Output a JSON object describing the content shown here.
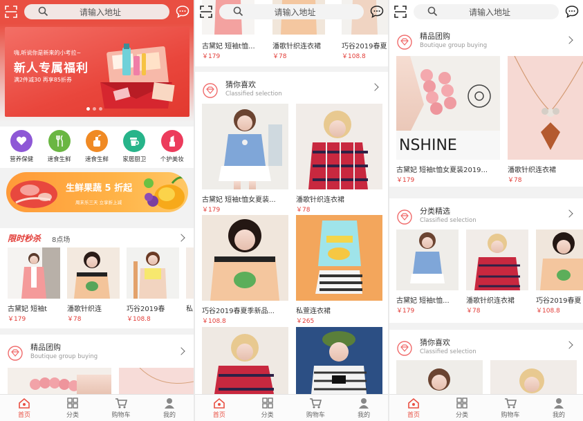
{
  "search": {
    "placeholder": "请输入地址"
  },
  "tabs": [
    {
      "label": "首页",
      "icon": "home-icon"
    },
    {
      "label": "分类",
      "icon": "grid-icon"
    },
    {
      "label": "购物车",
      "icon": "cart-icon"
    },
    {
      "label": "我的",
      "icon": "user-icon"
    }
  ],
  "banner": {
    "subtitle": "嗨,听说你是新来的小考拉~",
    "title": "新人专属福利",
    "desc": "满2件减30 再享85折券"
  },
  "categories": [
    {
      "label": "营养保健",
      "color": "#8e58d6",
      "icon": "heart-icon"
    },
    {
      "label": "速食生鲜",
      "color": "#6ab642",
      "icon": "utensils-icon"
    },
    {
      "label": "速食生鲜",
      "color": "#f08a24",
      "icon": "bottle-icon"
    },
    {
      "label": "家居厨卫",
      "color": "#27b48a",
      "icon": "cup-icon"
    },
    {
      "label": "个护美妆",
      "color": "#ec3c5c",
      "icon": "lipstick-icon"
    }
  ],
  "promo": {
    "text": "生鲜果蔬 5 折起",
    "date": "周末乐三天 立享折上减"
  },
  "flash_sale": {
    "title": "限时秒杀",
    "subtitle": "8点场",
    "items": [
      {
        "name": "古黛妃 短袖t",
        "price": "￥179"
      },
      {
        "name": "潘歌针织连",
        "price": "￥78"
      },
      {
        "name": "巧谷2019春",
        "price": "￥108.8"
      },
      {
        "name": "私",
        "price": ""
      }
    ]
  },
  "boutique": {
    "title": "精品团购",
    "subtitle": "Boutique group buying",
    "items": [
      {
        "name": "古黛妃 短袖t恤女夏装2019...",
        "price": "￥179"
      },
      {
        "name": "潘歌针织连衣裙",
        "price": "￥78"
      }
    ]
  },
  "guess": {
    "title": "猜你喜欢",
    "subtitle": "Classified selection"
  },
  "classified": {
    "title": "分类精选",
    "subtitle": "Classified selection"
  },
  "top_strip": [
    {
      "name": "古黛妃 短袖t恤...",
      "price": "￥179"
    },
    {
      "name": "潘歌针织连衣裙",
      "price": "￥78"
    },
    {
      "name": "巧谷2019春夏",
      "price": "￥108.8"
    }
  ],
  "guess_items": [
    {
      "name": "古黛妃 短袖t恤女夏装...",
      "price": "￥179"
    },
    {
      "name": "潘歌针织连衣裙",
      "price": "￥78"
    },
    {
      "name": "巧谷2019春夏季新品...",
      "price": "￥108.8"
    },
    {
      "name": "私萱连衣裙",
      "price": "￥265"
    }
  ],
  "classified_items": [
    {
      "name": "古黛妃 短袖t恤...",
      "price": "￥179"
    },
    {
      "name": "潘歌针织连衣裙",
      "price": "￥78"
    },
    {
      "name": "巧谷2019春夏",
      "price": "￥108.8"
    }
  ],
  "colors": {
    "accent": "#e94f42",
    "price": "#e23b36"
  }
}
